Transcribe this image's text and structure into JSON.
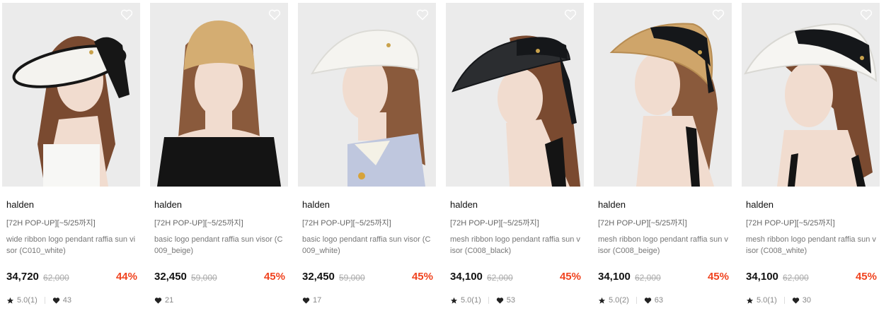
{
  "products": [
    {
      "brand": "halden",
      "tag": "[72H POP-UP][~5/25까지]",
      "name": "wide ribbon logo pendant raffia sun visor (C010_white)",
      "price": "34,720",
      "original_price": "62,000",
      "discount": "44%",
      "rating": "5.0(1)",
      "likes": "43",
      "hat_color": "#f4f3ef",
      "band_color": "#161616"
    },
    {
      "brand": "halden",
      "tag": "[72H POP-UP][~5/25까지]",
      "name": "basic logo pendant raffia sun visor (C009_beige)",
      "price": "32,450",
      "original_price": "59,000",
      "discount": "45%",
      "rating": "",
      "likes": "21",
      "hat_color": "#d4ad72",
      "band_color": "#c49c60"
    },
    {
      "brand": "halden",
      "tag": "[72H POP-UP][~5/25까지]",
      "name": "basic logo pendant raffia sun visor (C009_white)",
      "price": "32,450",
      "original_price": "59,000",
      "discount": "45%",
      "rating": "",
      "likes": "17",
      "hat_color": "#f5f4f0",
      "band_color": "#e4e3de"
    },
    {
      "brand": "halden",
      "tag": "[72H POP-UP][~5/25까지]",
      "name": "mesh ribbon logo pendant raffia sun visor (C008_black)",
      "price": "34,100",
      "original_price": "62,000",
      "discount": "45%",
      "rating": "5.0(1)",
      "likes": "53",
      "hat_color": "#2b2d30",
      "band_color": "#15171a"
    },
    {
      "brand": "halden",
      "tag": "[72H POP-UP][~5/25까지]",
      "name": "mesh ribbon logo pendant raffia sun visor (C008_beige)",
      "price": "34,100",
      "original_price": "62,000",
      "discount": "45%",
      "rating": "5.0(2)",
      "likes": "63",
      "hat_color": "#cfa56a",
      "band_color": "#15171a"
    },
    {
      "brand": "halden",
      "tag": "[72H POP-UP][~5/25까지]",
      "name": "mesh ribbon logo pendant raffia sun visor (C008_white)",
      "price": "34,100",
      "original_price": "62,000",
      "discount": "45%",
      "rating": "5.0(1)",
      "likes": "30",
      "hat_color": "#f6f5f2",
      "band_color": "#15171a"
    }
  ],
  "icons": {
    "wishlist": "heart-outline-icon",
    "rating": "star-icon",
    "likes": "heart-icon"
  },
  "colors": {
    "discount": "#f0431f",
    "price": "#111111",
    "strike": "#aaaaaa",
    "hair": "#8a5a3c",
    "skin": "#f1dccf"
  }
}
